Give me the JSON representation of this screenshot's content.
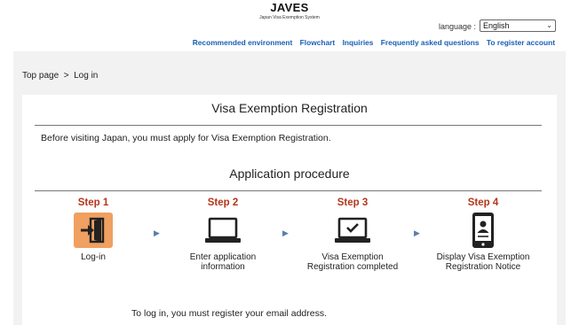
{
  "header": {
    "logo_title": "JAVES",
    "logo_subtitle": "Japan Visa Exemption System",
    "language_label": "language :",
    "language_selected": "English"
  },
  "nav": {
    "items": [
      {
        "label": "Recommended environment"
      },
      {
        "label": "Flowchart"
      },
      {
        "label": "Inquiries"
      },
      {
        "label": "Frequently asked questions"
      },
      {
        "label": "To register account"
      }
    ]
  },
  "breadcrumb": "Top page  >  Log in",
  "main": {
    "title": "Visa Exemption Registration",
    "intro": "Before visiting Japan, you must apply for Visa Exemption Registration.",
    "procedure_title": "Application procedure",
    "steps": [
      {
        "label": "Step 1",
        "caption": "Log-in",
        "icon": "login-door-icon"
      },
      {
        "label": "Step 2",
        "caption": "Enter application\ninformation",
        "icon": "laptop-icon"
      },
      {
        "label": "Step 3",
        "caption": "Visa Exemption\nRegistration completed",
        "icon": "laptop-check-icon"
      },
      {
        "label": "Step 4",
        "caption": "Display Visa Exemption\nRegistration Notice",
        "icon": "tablet-person-icon"
      }
    ],
    "bottom_note": "To log in, you must register your email address."
  },
  "colors": {
    "step_red": "#b3361b",
    "nav_blue": "#1a5fb4",
    "login_orange": "#f0a060",
    "arrow_blue": "#5b7fa8"
  }
}
